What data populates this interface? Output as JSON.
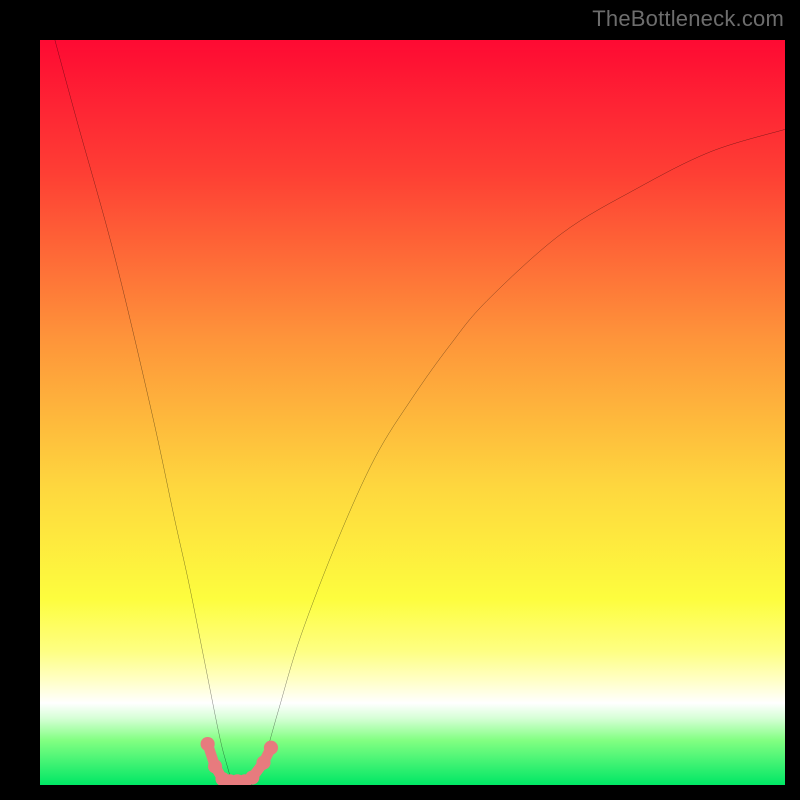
{
  "attribution": "TheBottleneck.com",
  "chart_data": {
    "type": "line",
    "title": "",
    "xlabel": "",
    "ylabel": "",
    "xlim": [
      0,
      100
    ],
    "ylim": [
      0,
      100
    ],
    "series": [
      {
        "name": "bottleneck-curve",
        "x": [
          2,
          5,
          10,
          15,
          18,
          20,
          22,
          24,
          25,
          26,
          27,
          28,
          29,
          30,
          32,
          35,
          40,
          45,
          50,
          55,
          60,
          70,
          80,
          90,
          100
        ],
        "values": [
          100,
          89,
          71,
          50,
          36,
          27,
          17,
          7,
          3,
          0,
          0,
          0,
          0.5,
          3,
          10,
          20,
          33,
          44,
          52,
          59,
          65,
          74,
          80,
          85,
          88
        ]
      },
      {
        "name": "minimum-marker",
        "x": [
          22.5,
          23.5,
          24.5,
          25.5,
          26.5,
          27.5,
          28.5,
          30.0,
          31.0
        ],
        "values": [
          5.5,
          2.5,
          0.8,
          0.5,
          0.5,
          0.5,
          1.0,
          3.0,
          5.0
        ]
      }
    ],
    "gradient_stops": [
      {
        "pct": 0,
        "color": "#fe0a33"
      },
      {
        "pct": 18,
        "color": "#fe3f34"
      },
      {
        "pct": 40,
        "color": "#fe943a"
      },
      {
        "pct": 60,
        "color": "#fed73e"
      },
      {
        "pct": 75,
        "color": "#fdfd3e"
      },
      {
        "pct": 82,
        "color": "#feff82"
      },
      {
        "pct": 86,
        "color": "#ffffc7"
      },
      {
        "pct": 89,
        "color": "#ffffff"
      },
      {
        "pct": 91,
        "color": "#d7ffd7"
      },
      {
        "pct": 94,
        "color": "#82ff82"
      },
      {
        "pct": 100,
        "color": "#00e765"
      }
    ],
    "colors": {
      "curve": "#000000",
      "marker": "#e77b7e",
      "frame": "#000000"
    }
  }
}
